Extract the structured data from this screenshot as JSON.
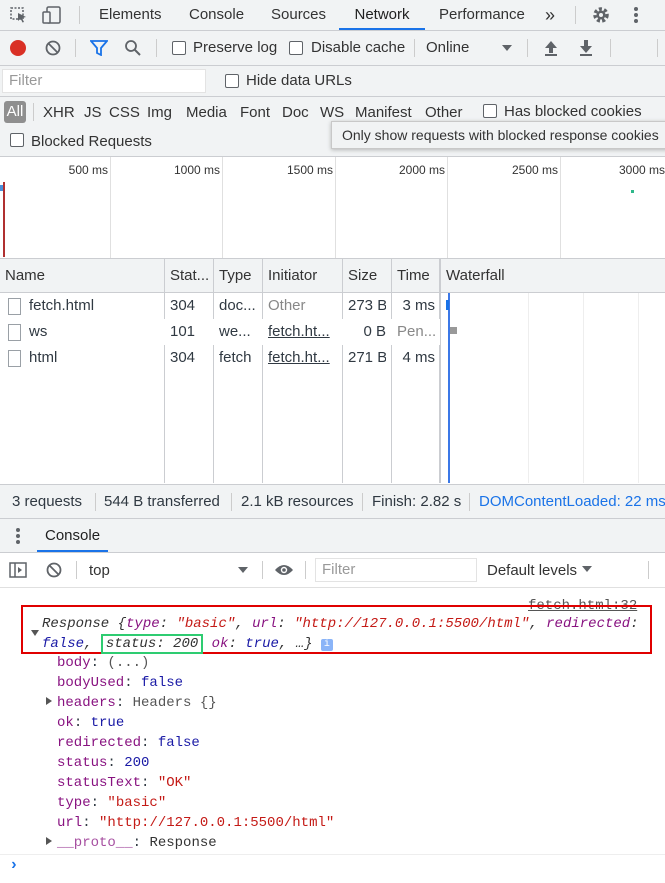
{
  "tabbar": {
    "tabs": [
      "Elements",
      "Console",
      "Sources",
      "Network",
      "Performance"
    ],
    "active": "Network",
    "more": "»"
  },
  "toolbar": {
    "preserve_log": "Preserve log",
    "disable_cache": "Disable cache",
    "throttle": "Online"
  },
  "filterbar": {
    "placeholder": "Filter",
    "hide_data_urls": "Hide data URLs",
    "types": [
      "All",
      "XHR",
      "JS",
      "CSS",
      "Img",
      "Media",
      "Font",
      "Doc",
      "WS",
      "Manifest",
      "Other"
    ],
    "has_blocked_cookies": "Has blocked cookies",
    "blocked_requests": "Blocked Requests",
    "tooltip": "Only show requests with blocked response cookies"
  },
  "overview": {
    "ticks": [
      "500 ms",
      "1000 ms",
      "1500 ms",
      "2000 ms",
      "2500 ms",
      "3000 ms"
    ]
  },
  "table": {
    "columns": [
      "Name",
      "Stat...",
      "Type",
      "Initiator",
      "Size",
      "Time",
      "Waterfall"
    ],
    "rows": [
      {
        "name": "fetch.html",
        "status": "304",
        "type": "doc...",
        "initiator": "Other",
        "size": "273 B",
        "time": "3 ms"
      },
      {
        "name": "ws",
        "status": "101",
        "type": "we...",
        "initiator": "fetch.ht...",
        "size": "0 B",
        "time": "Pen..."
      },
      {
        "name": "html",
        "status": "304",
        "type": "fetch",
        "initiator": "fetch.ht...",
        "size": "271 B",
        "time": "4 ms"
      }
    ]
  },
  "summary": {
    "requests": "3 requests",
    "transferred": "544 B transferred",
    "resources": "2.1 kB resources",
    "finish": "Finish: 2.82 s",
    "dcl": "DOMContentLoaded: 22 ms"
  },
  "drawer": {
    "tab": "Console",
    "context": "top",
    "filter_placeholder": "Filter",
    "levels": "Default levels"
  },
  "console": {
    "source_link": "fetch.html:32",
    "summary_line1_prefix": "Response {",
    "summary_type_key": "type",
    "summary_type_val": "\"basic\"",
    "summary_url_key": "url",
    "summary_url_val": "\"http://127.0.0.1:5500/html\"",
    "summary_redirected_key": "redirected",
    "summary_redirected_val": "false",
    "summary_status": "status: 200",
    "summary_ok_key": "ok",
    "summary_ok_val": "true",
    "summary_tail": ", …}",
    "properties": [
      {
        "key": "body",
        "value": "(...)",
        "kind": "dim"
      },
      {
        "key": "bodyUsed",
        "value": "false",
        "kind": "kw"
      },
      {
        "key": "headers",
        "value": "Headers {}",
        "kind": "dim",
        "expandable": true
      },
      {
        "key": "ok",
        "value": "true",
        "kind": "kw"
      },
      {
        "key": "redirected",
        "value": "false",
        "kind": "kw"
      },
      {
        "key": "status",
        "value": "200",
        "kind": "kw"
      },
      {
        "key": "statusText",
        "value": "\"OK\"",
        "kind": "str"
      },
      {
        "key": "type",
        "value": "\"basic\"",
        "kind": "str"
      },
      {
        "key": "url",
        "value": "\"http://127.0.0.1:5500/html\"",
        "kind": "str"
      },
      {
        "key": "__proto__",
        "value": "Response",
        "kind": "dim",
        "expandable": true
      }
    ],
    "prompt": "›"
  },
  "colors": {
    "accent": "#1a73e8",
    "record": "#d93025",
    "highlight_red": "#e00000",
    "highlight_green": "#2ecc71"
  }
}
